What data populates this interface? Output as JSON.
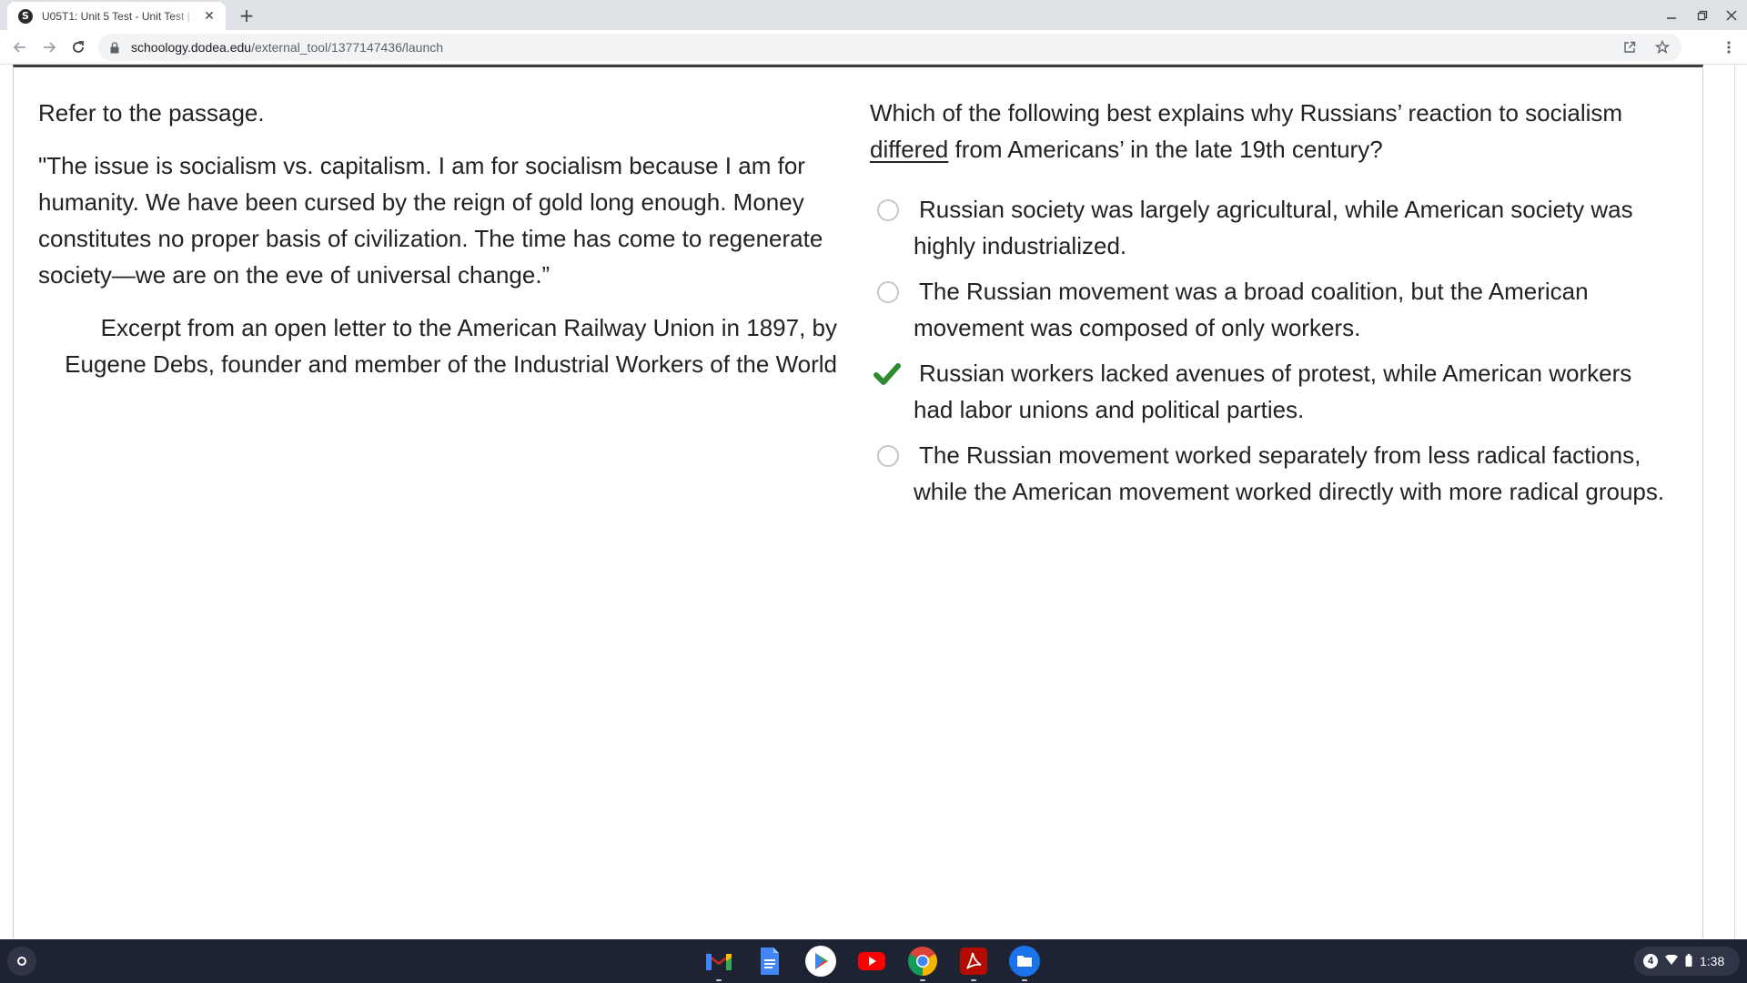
{
  "browser": {
    "tab": {
      "favicon_letter": "S",
      "title": "U05T1: Unit 5 Test - Unit Test | S"
    },
    "url": {
      "host": "schoology.dodea.edu",
      "path": "/external_tool/1377147436/launch"
    }
  },
  "passage": {
    "instruction": "Refer to the passage.",
    "quote": "\"The issue is socialism vs. capitalism. I am for socialism because I am for humanity. We have been cursed by the reign of gold long enough. Money constitutes no proper basis of civilization. The time has come to regenerate society—we are on the eve of universal change.”",
    "citation": "Excerpt from an open letter to the American Railway Union in 1897, by Eugene Debs, founder and member of the Industrial Workers of the World"
  },
  "question": {
    "prompt_before": "Which of the following best explains why Russians’ reaction to socialism ",
    "prompt_underlined": "differed",
    "prompt_after": " from Americans’ in the late 19th century?",
    "choices": [
      {
        "text": "Russian society was largely agricultural, while American society was highly industrialized.",
        "state": "unselected"
      },
      {
        "text": "The Russian movement was a broad coalition, but the American movement was composed of only workers.",
        "state": "unselected"
      },
      {
        "text": "Russian workers lacked avenues of protest, while American workers had labor unions and political parties.",
        "state": "correct"
      },
      {
        "text": "The Russian movement worked separately from less radical factions, while the American movement worked directly with more radical groups.",
        "state": "unselected"
      }
    ]
  },
  "shelf": {
    "apps": [
      "gmail-icon",
      "google-docs-icon",
      "play-store-icon",
      "youtube-icon",
      "chrome-icon",
      "acrobat-icon",
      "files-icon"
    ],
    "notification_count": "4",
    "time": "1:38"
  },
  "colors": {
    "correct_check": "#2e8b2e",
    "shelf_bg": "#1e2334"
  }
}
